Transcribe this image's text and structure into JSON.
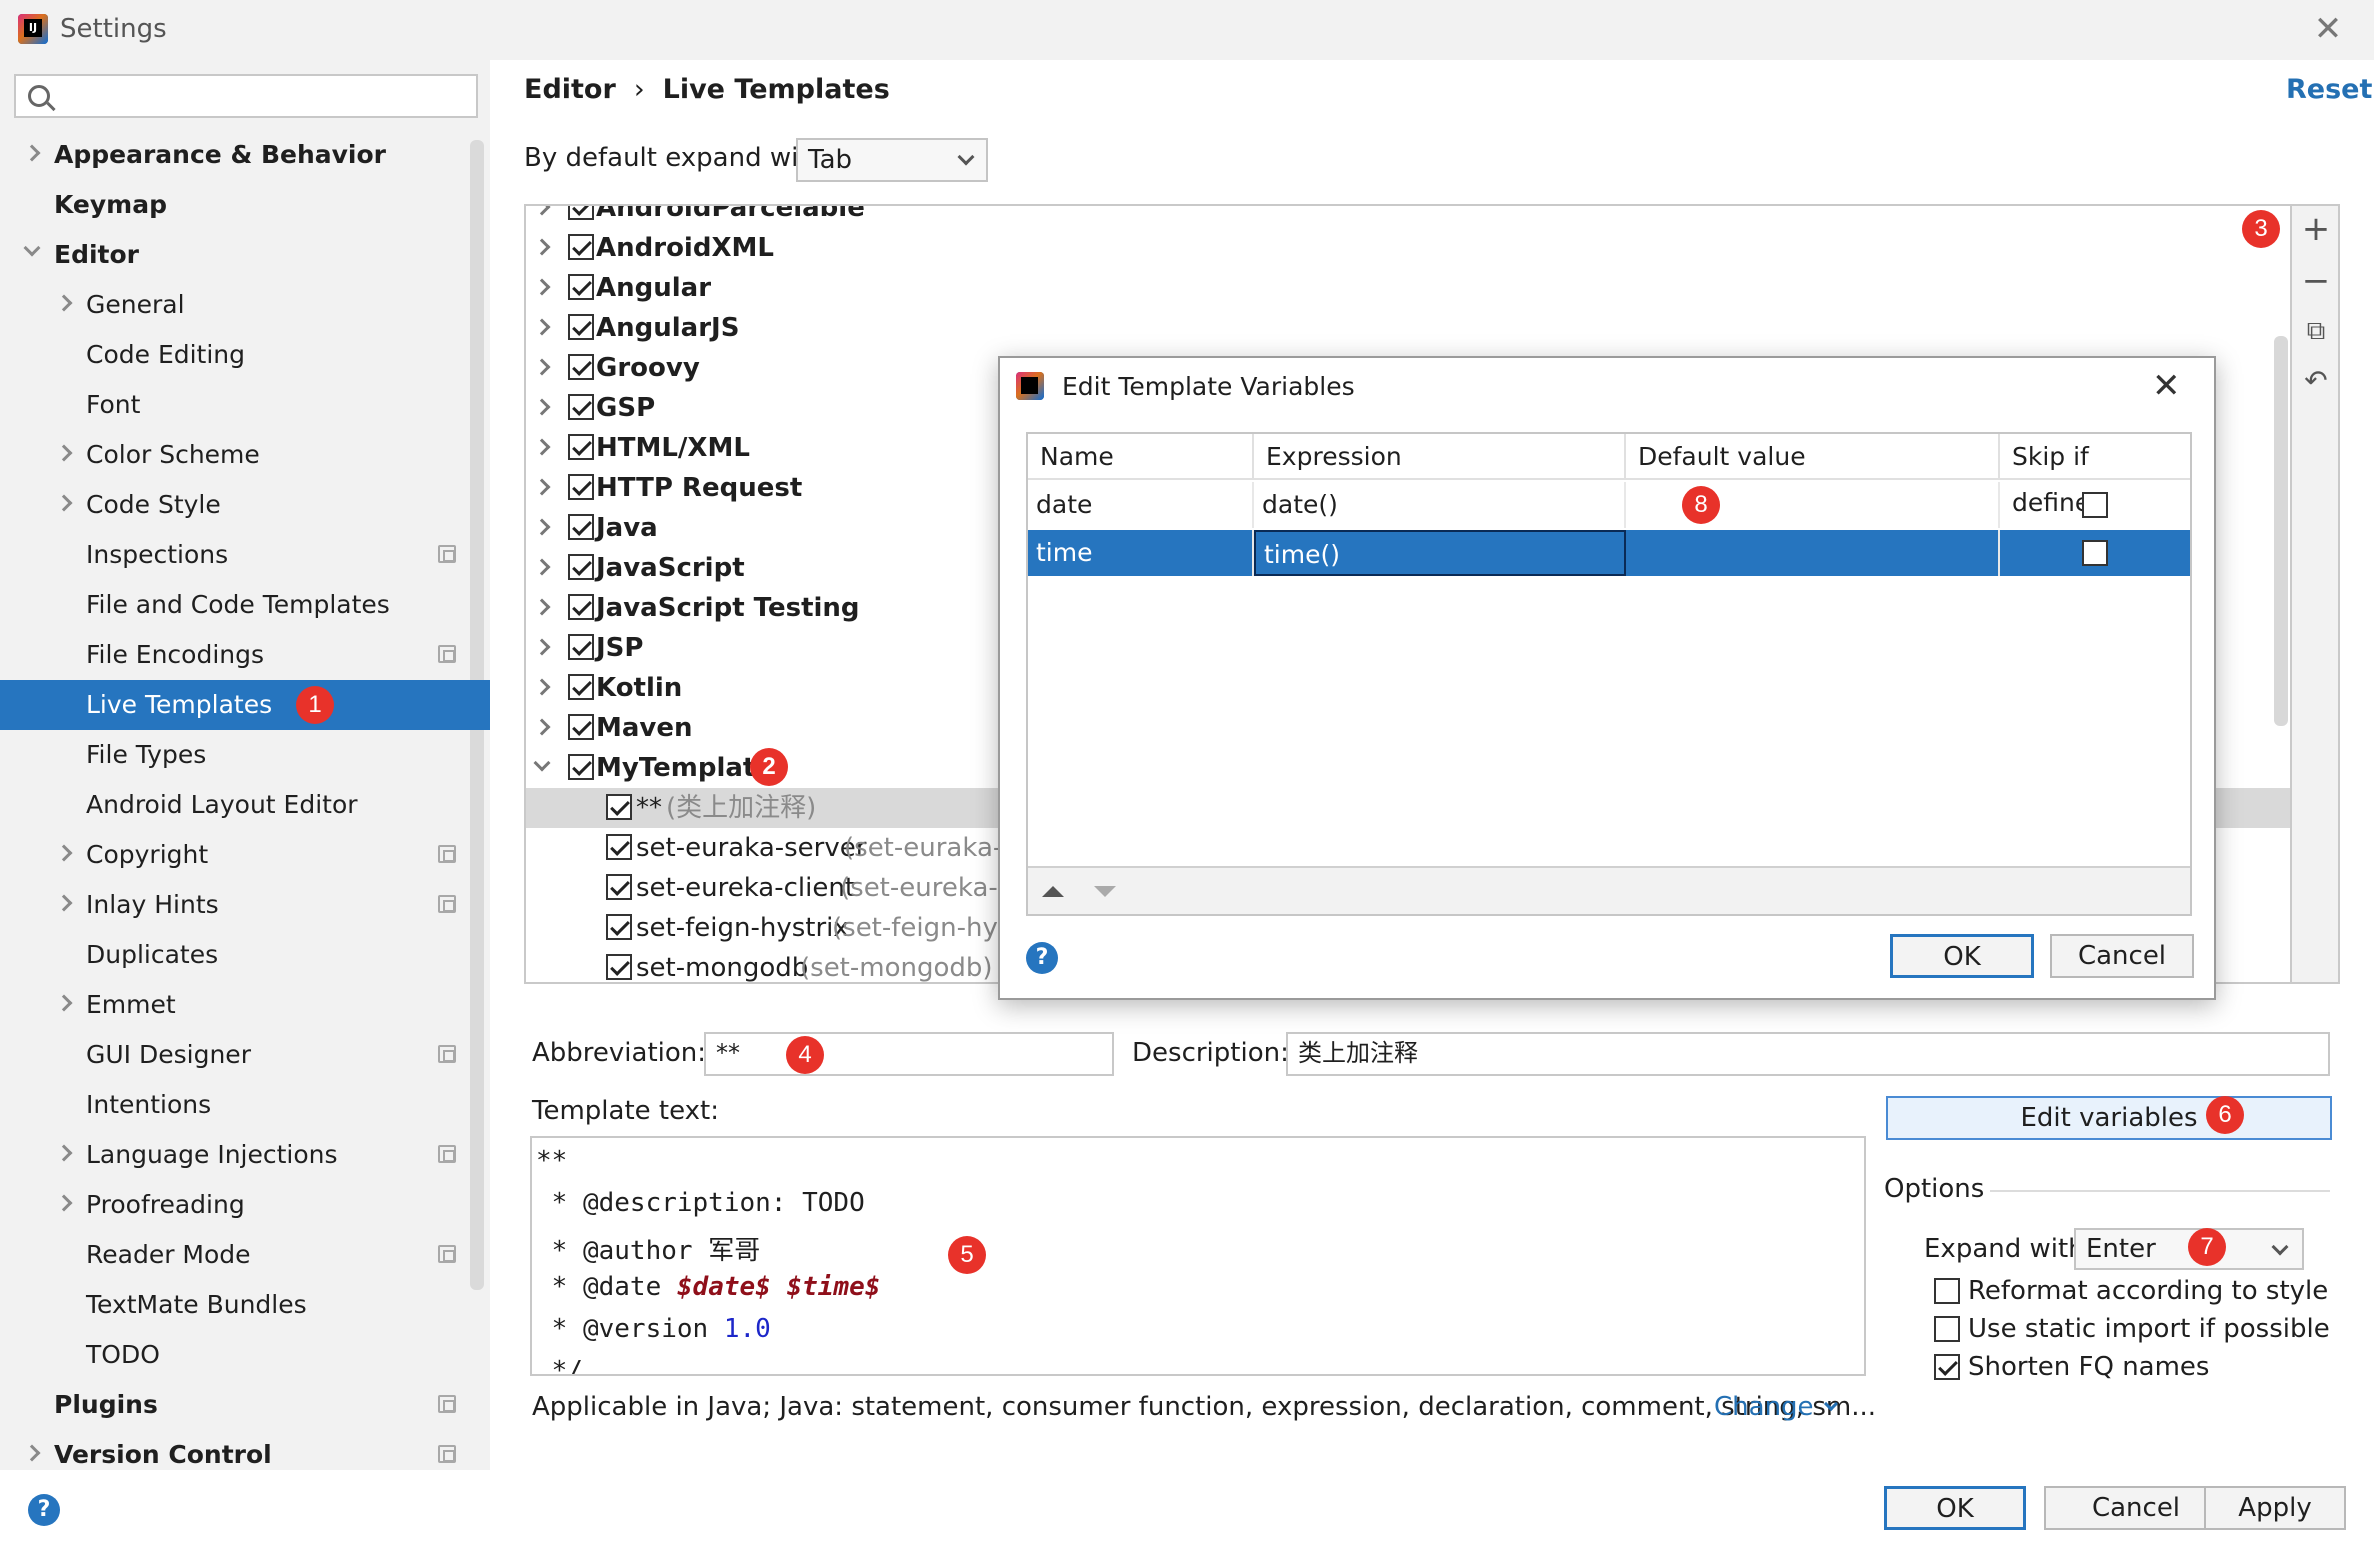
{
  "window": {
    "title": "Settings"
  },
  "sidebar": {
    "search_placeholder": "",
    "items": [
      {
        "label": "Appearance & Behavior"
      },
      {
        "label": "Keymap"
      },
      {
        "label": "Editor"
      },
      {
        "label": "General"
      },
      {
        "label": "Code Editing"
      },
      {
        "label": "Font"
      },
      {
        "label": "Color Scheme"
      },
      {
        "label": "Code Style"
      },
      {
        "label": "Inspections"
      },
      {
        "label": "File and Code Templates"
      },
      {
        "label": "File Encodings"
      },
      {
        "label": "Live Templates"
      },
      {
        "label": "File Types"
      },
      {
        "label": "Android Layout Editor"
      },
      {
        "label": "Copyright"
      },
      {
        "label": "Inlay Hints"
      },
      {
        "label": "Duplicates"
      },
      {
        "label": "Emmet"
      },
      {
        "label": "GUI Designer"
      },
      {
        "label": "Intentions"
      },
      {
        "label": "Language Injections"
      },
      {
        "label": "Proofreading"
      },
      {
        "label": "Reader Mode"
      },
      {
        "label": "TextMate Bundles"
      },
      {
        "label": "TODO"
      },
      {
        "label": "Plugins"
      },
      {
        "label": "Version Control"
      }
    ]
  },
  "header": {
    "breadcrumb": [
      "Editor",
      "›",
      "Live Templates"
    ],
    "reset_label": "Reset",
    "expand_label": "By default expand with",
    "expand_value": "Tab"
  },
  "templates": {
    "groups": [
      {
        "label": "AndroidParcelable"
      },
      {
        "label": "AndroidXML"
      },
      {
        "label": "Angular"
      },
      {
        "label": "AngularJS"
      },
      {
        "label": "Groovy"
      },
      {
        "label": "GSP"
      },
      {
        "label": "HTML/XML"
      },
      {
        "label": "HTTP Request"
      },
      {
        "label": "Java"
      },
      {
        "label": "JavaScript"
      },
      {
        "label": "JavaScript Testing"
      },
      {
        "label": "JSP"
      },
      {
        "label": "Kotlin"
      },
      {
        "label": "Maven"
      },
      {
        "label": "MyTemplate"
      }
    ],
    "children": [
      {
        "name": "**",
        "desc": "(类上加注释)"
      },
      {
        "name": "set-euraka-server",
        "desc": "(set-euraka-se"
      },
      {
        "name": "set-eureka-client",
        "desc": "(set-eureka-cli"
      },
      {
        "name": "set-feign-hystrix",
        "desc": "(set-feign-hyst"
      },
      {
        "name": "set-mongodb",
        "desc": "(set-mongodb)"
      }
    ]
  },
  "badges": [
    "1",
    "2",
    "3",
    "4",
    "5",
    "6",
    "7",
    "8"
  ],
  "form": {
    "abbreviation_label": "Abbreviation:",
    "abbreviation_value": "**",
    "description_label": "Description:",
    "description_value": "类上加注释",
    "template_text_label": "Template text:",
    "template_lines": {
      "l1": "**",
      "l2": " * @description: TODO",
      "l3_prefix": " * @author ",
      "l3_value": "军哥",
      "l4_prefix": " * @date ",
      "l4_var1": "$date$",
      "l4_var2": "$time$",
      "l5_prefix": " * @version ",
      "l5_value": "1.0",
      "l6": " */"
    },
    "edit_variables_label": "Edit variables",
    "options_label": "Options",
    "expand_with_label": "Expand with",
    "expand_with_value": "Enter",
    "options": [
      {
        "label": "Reformat according to style",
        "checked": false
      },
      {
        "label": "Use static import if possible",
        "checked": false
      },
      {
        "label": "Shorten FQ names",
        "checked": true
      }
    ],
    "applicable_text": "Applicable in Java; Java: statement, consumer function, expression, declaration, comment, string, sm...",
    "change_label": "Change"
  },
  "footer": {
    "ok": "OK",
    "cancel": "Cancel",
    "apply": "Apply"
  },
  "dialog": {
    "title": "Edit Template Variables",
    "columns": [
      "Name",
      "Expression",
      "Default value",
      "Skip if defined"
    ],
    "rows": [
      {
        "name": "date",
        "expression": "date()",
        "default": "",
        "skip": false
      },
      {
        "name": "time",
        "expression": "time()",
        "default": "",
        "skip": false
      }
    ],
    "ok": "OK",
    "cancel": "Cancel"
  },
  "colors": {
    "accent": "#2675bf",
    "badge": "#e8322a",
    "link": "#2470b3",
    "template_var": "#8f0f1a"
  }
}
